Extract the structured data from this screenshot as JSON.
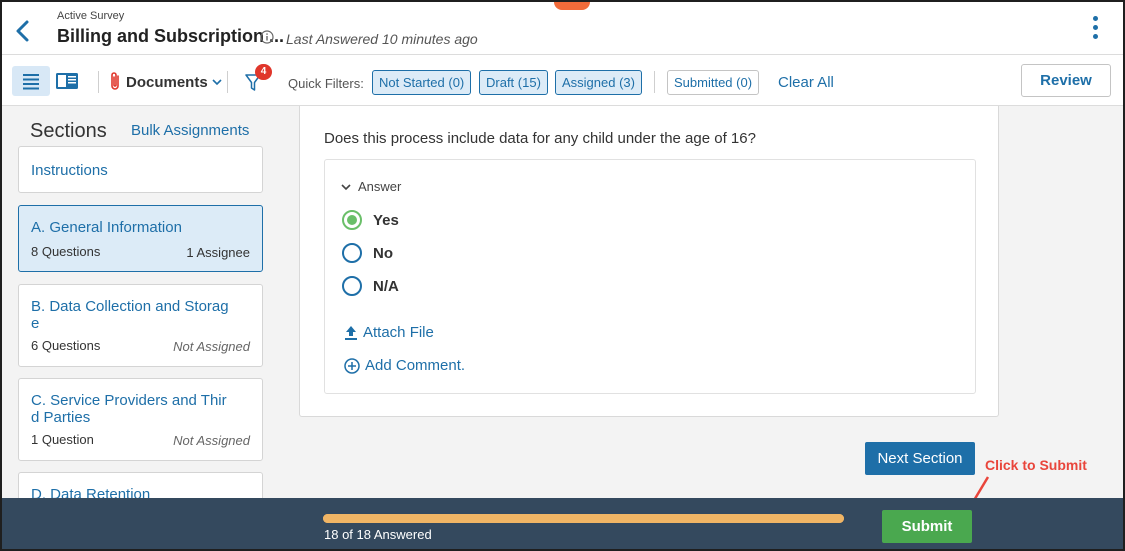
{
  "header": {
    "eyebrow": "Active Survey",
    "title": "Billing and Subscription ...",
    "last_answered": "Last Answered 10 minutes ago"
  },
  "toolbar": {
    "documents_label": "Documents",
    "filter_badge": "4",
    "quick_filters_label": "Quick Filters:",
    "chips": [
      {
        "label": "Not Started (0)"
      },
      {
        "label": "Draft (15)"
      },
      {
        "label": "Assigned (3)"
      },
      {
        "label": "Submitted (0)"
      }
    ],
    "clear_all": "Clear All",
    "review": "Review"
  },
  "sidebar": {
    "title": "Sections",
    "bulk_link": "Bulk Assignments",
    "instructions": "Instructions",
    "sections": [
      {
        "title": "A. General Information",
        "count": "8 Questions",
        "assign": "1 Assignee"
      },
      {
        "title": "B. Data Collection and Storag\ne",
        "count": "6 Questions",
        "assign": "Not Assigned"
      },
      {
        "title": "C. Service Providers and Thir\nd Parties",
        "count": "1 Question",
        "assign": "Not Assigned"
      },
      {
        "title": "D. Data Retention"
      }
    ]
  },
  "question": {
    "text": "Does this process include data for any child under the age of 16?",
    "answer_label": "Answer",
    "options": [
      "Yes",
      "No",
      "N/A"
    ],
    "selected": "Yes",
    "attach": "Attach File",
    "comment": "Add Comment."
  },
  "next_section": "Next Section",
  "annotation": "Click to Submit",
  "footer": {
    "progress_text": "18 of 18 Answered",
    "progress_fraction": 1.0,
    "submit": "Submit"
  },
  "colors": {
    "accent": "#1e6fa8",
    "submit": "#4aa84f",
    "footer": "#34495e",
    "progress": "#f0b565",
    "annotation": "#e9453b"
  }
}
